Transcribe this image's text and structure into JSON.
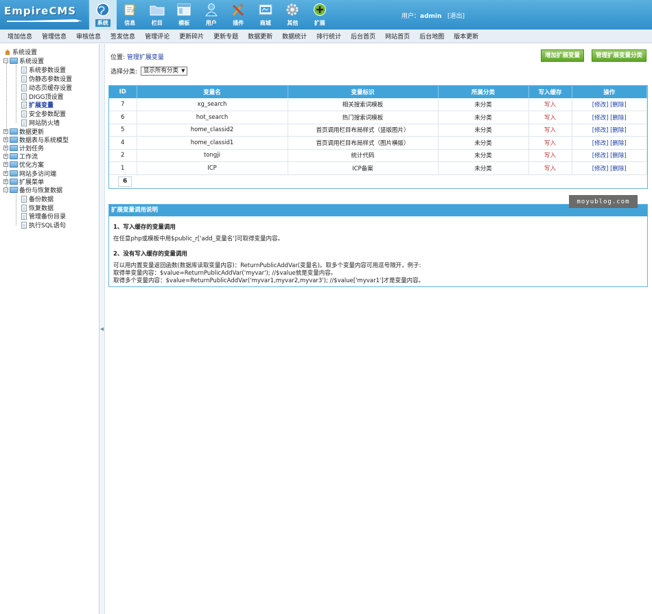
{
  "brand": {
    "logo_text": "EmpireCMS"
  },
  "topnav": [
    {
      "label": "系统",
      "icon": "globe-icon",
      "active": true
    },
    {
      "label": "信息",
      "icon": "edit-icon"
    },
    {
      "label": "栏目",
      "icon": "folder-icon"
    },
    {
      "label": "模板",
      "icon": "template-icon"
    },
    {
      "label": "用户",
      "icon": "user-icon"
    },
    {
      "label": "插件",
      "icon": "tools-icon"
    },
    {
      "label": "商城",
      "icon": "shop-icon"
    },
    {
      "label": "其他",
      "icon": "gear-icon"
    },
    {
      "label": "扩展",
      "icon": "plus-icon"
    }
  ],
  "user": {
    "prefix": "用户：",
    "name": "admin",
    "logout": "[退出]"
  },
  "subnav": [
    "增加信息",
    "管理信息",
    "审核信息",
    "签发信息",
    "管理评论",
    "更新碎片",
    "更新专题",
    "数据更新",
    "数据统计",
    "排行统计",
    "后台首页",
    "网站首页",
    "后台地图",
    "版本更新"
  ],
  "tree": {
    "root": "系统设置",
    "nodes": [
      {
        "label": "系统设置",
        "type": "folder",
        "expanded": true
      },
      {
        "label": "系统参数设置",
        "type": "doc"
      },
      {
        "label": "伪静态参数设置",
        "type": "doc"
      },
      {
        "label": "动态页缓存设置",
        "type": "doc"
      },
      {
        "label": "DIGG顶设置",
        "type": "doc"
      },
      {
        "label": "扩展变量",
        "type": "doc",
        "selected": true
      },
      {
        "label": "安全参数配置",
        "type": "doc"
      },
      {
        "label": "网站防火墙",
        "type": "doc"
      },
      {
        "label": "数据更新",
        "type": "folder"
      },
      {
        "label": "数据表与系统模型",
        "type": "folder"
      },
      {
        "label": "计划任务",
        "type": "folder"
      },
      {
        "label": "工作流",
        "type": "folder"
      },
      {
        "label": "优化方案",
        "type": "folder"
      },
      {
        "label": "网站多访问端",
        "type": "folder"
      },
      {
        "label": "扩展菜单",
        "type": "folder"
      },
      {
        "label": "备份与恢复数据",
        "type": "folder",
        "expanded": true
      },
      {
        "label": "备份数据",
        "type": "doc"
      },
      {
        "label": "恢复数据",
        "type": "doc"
      },
      {
        "label": "管理备份目录",
        "type": "doc"
      },
      {
        "label": "执行SQL语句",
        "type": "doc"
      }
    ]
  },
  "location": {
    "prefix": "位置: ",
    "link": "管理扩展变量"
  },
  "buttons": {
    "add_var": "增加扩展变量",
    "manage_class": "管理扩展变量分类"
  },
  "filter": {
    "label": "选择分类:",
    "selected": "显示所有分类"
  },
  "table": {
    "columns": [
      "ID",
      "变量名",
      "变量标识",
      "所属分类",
      "写入缓存",
      "操作"
    ],
    "rows": [
      {
        "id": "7",
        "name": "xg_search",
        "title": "相关搜索词模板",
        "class": "未分类",
        "cache": "写入",
        "edit": "[修改]",
        "del": "[删除]"
      },
      {
        "id": "6",
        "name": "hot_search",
        "title": "热门搜索词模板",
        "class": "未分类",
        "cache": "写入",
        "edit": "[修改]",
        "del": "[删除]"
      },
      {
        "id": "5",
        "name": "home_classid2",
        "title": "首页调用栏目布局样式（竖版图片）",
        "class": "未分类",
        "cache": "写入",
        "edit": "[修改]",
        "del": "[删除]"
      },
      {
        "id": "4",
        "name": "home_classid1",
        "title": "首页调用栏目布局样式（图片横版）",
        "class": "未分类",
        "cache": "写入",
        "edit": "[修改]",
        "del": "[删除]"
      },
      {
        "id": "2",
        "name": "tongji",
        "title": "统计代码",
        "class": "未分类",
        "cache": "写入",
        "edit": "[修改]",
        "del": "[删除]"
      },
      {
        "id": "1",
        "name": "ICP",
        "title": "ICP备案",
        "class": "未分类",
        "cache": "写入",
        "edit": "[修改]",
        "del": "[删除]"
      }
    ],
    "page": "6"
  },
  "watermark": "moyublog.com",
  "info": {
    "title": "扩展变量调用说明",
    "h1": "1、写入缓存的变量调用",
    "p1": "在任意php或模板中用$public_r['add_变量名']可取得变量内容。",
    "h2": "2、没有写入缓存的变量调用",
    "p2": "可以用内置变量返回函数(数据库读取变量内容)：ReturnPublicAddVar(变量名)。取多个变量内容可用逗号隔开，例子:",
    "p3": "取得单变量内容：$value=ReturnPublicAddVar('myvar'); //$value就是变量内容。",
    "p4": "取得多个变量内容：$value=ReturnPublicAddVar('myvar1,myvar2,myvar3'); //$value['myvar1']才是变量内容。"
  }
}
